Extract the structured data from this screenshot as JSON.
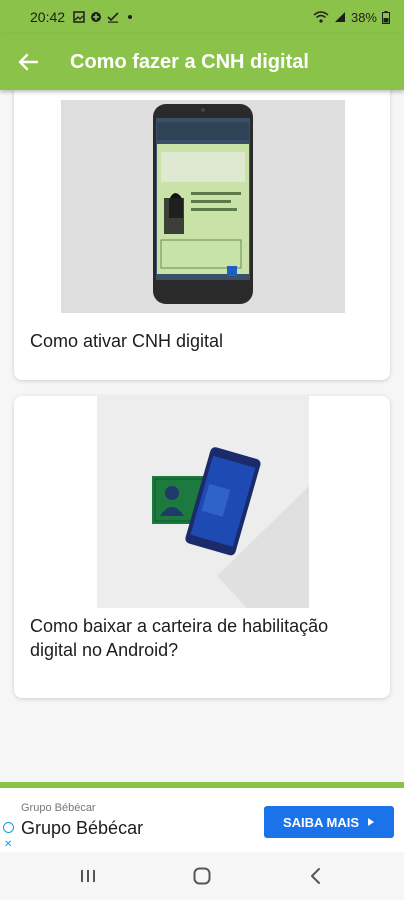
{
  "status_bar": {
    "time": "20:42",
    "battery": "38%"
  },
  "app_bar": {
    "title": "Como fazer a CNH digital"
  },
  "cards": [
    {
      "label": "Como ativar CNH digital"
    },
    {
      "label": "Como baixar a carteira de habilitação digital no Android?"
    }
  ],
  "ad": {
    "small_label": "Grupo Bébécar",
    "title": "Grupo Bébécar",
    "cta_label": "SAIBA MAIS"
  },
  "colors": {
    "primary": "#8bc34a",
    "accent_blue": "#1a73e8"
  }
}
